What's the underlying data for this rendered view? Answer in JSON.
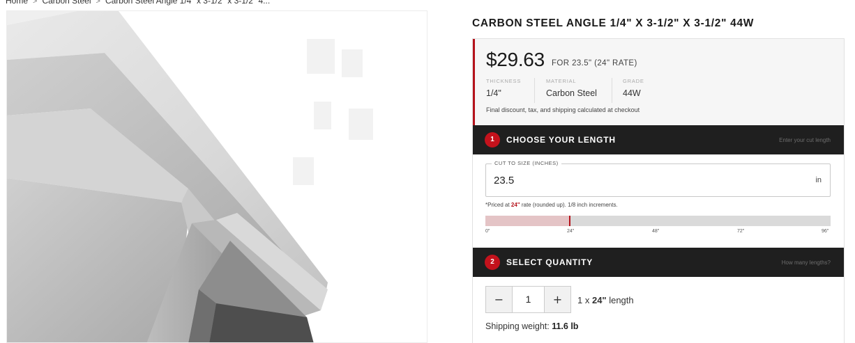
{
  "breadcrumb": {
    "items": [
      "Home",
      "Carbon Steel",
      "Carbon Steel Angle 1/4\" x 3-1/2\" x 3-1/2\" 4..."
    ]
  },
  "product": {
    "title": "CARBON STEEL ANGLE 1/4\" X 3-1/2\" X 3-1/2\" 44W",
    "price": "$29.63",
    "price_note": "FOR 23.5\" (24\" RATE)",
    "specs": [
      {
        "label": "THICKNESS",
        "value": "1/4\""
      },
      {
        "label": "MATERIAL",
        "value": "Carbon Steel"
      },
      {
        "label": "GRADE",
        "value": "44W"
      }
    ],
    "checkout_note": "Final discount, tax, and shipping calculated at checkout"
  },
  "step1": {
    "number": "1",
    "title": "CHOOSE YOUR LENGTH",
    "hint": "Enter your cut length",
    "field_label": "CUT TO SIZE (INCHES)",
    "field_value": "23.5",
    "unit": "in",
    "note_prefix": "*Priced at ",
    "note_rate": "24\"",
    "note_suffix": " rate (rounded up). 1/8 inch increments.",
    "slider_max_inches": 96,
    "slider_value_inches": 23.5,
    "ticks": [
      "0\"",
      "24\"",
      "48\"",
      "72\"",
      "96\""
    ]
  },
  "step2": {
    "number": "2",
    "title": "SELECT QUANTITY",
    "hint": "How many lengths?",
    "minus_label": "−",
    "plus_label": "+",
    "quantity": "1",
    "desc_prefix": "1 x ",
    "desc_length": "24\"",
    "desc_suffix": " length"
  },
  "shipping": {
    "label": "Shipping weight: ",
    "value": "11.6 lb"
  },
  "colors": {
    "accent": "#b5121b",
    "step_bar": "#1f1f1f",
    "price_bg": "#f6f6f6"
  }
}
